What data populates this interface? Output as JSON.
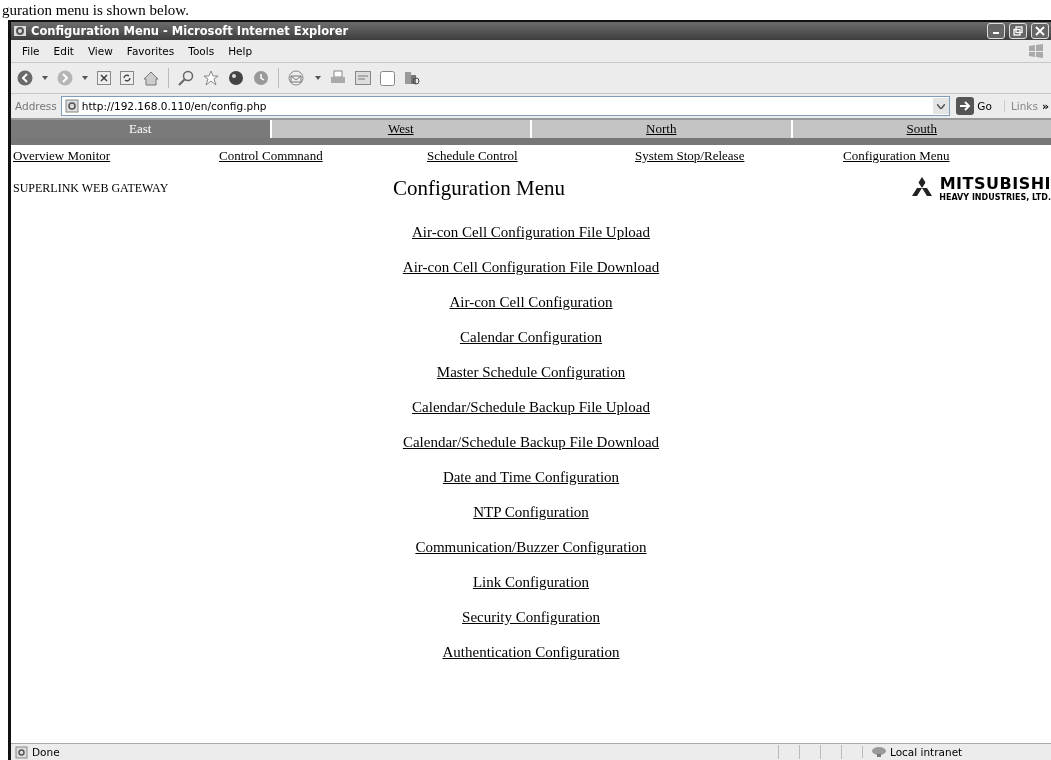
{
  "caption": "guration menu is shown below.",
  "window": {
    "title": "Configuration Menu - Microsoft Internet Explorer"
  },
  "menu_bar": [
    "File",
    "Edit",
    "View",
    "Favorites",
    "Tools",
    "Help"
  ],
  "address_bar": {
    "label": "Address",
    "value": "http://192.168.0.110/en/config.php",
    "go": "Go",
    "links": "Links",
    "more": "»"
  },
  "tabs": [
    {
      "label": "East",
      "selected": true
    },
    {
      "label": "West",
      "selected": false
    },
    {
      "label": "North",
      "selected": false
    },
    {
      "label": "South",
      "selected": false
    }
  ],
  "nav_links": [
    "Overview Monitor",
    "Control Commnand",
    "Schedule Control",
    "System Stop/Release",
    "Configuration Menu"
  ],
  "header": {
    "brand": "SUPERLINK WEB GATEWAY",
    "title": "Configuration Menu",
    "logo_name": "MITSUBISHI",
    "logo_sub": "HEAVY INDUSTRIES, LTD."
  },
  "menu_links": [
    "Air-con Cell Configuration File Upload",
    "Air-con Cell Configuration File Download",
    "Air-con Cell Configuration",
    "Calendar Configuration",
    "Master Schedule Configuration",
    "Calendar/Schedule Backup File Upload",
    "Calendar/Schedule Backup File Download",
    "Date and Time Configuration",
    "NTP Configuration",
    "Communication/Buzzer Configuration",
    "Link Configuration",
    "Security Configuration",
    "Authentication Configuration"
  ],
  "status_bar": {
    "text": "Done",
    "zone": "Local intranet"
  }
}
